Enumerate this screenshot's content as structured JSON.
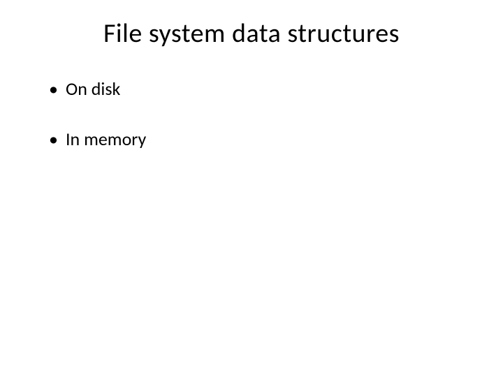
{
  "slide": {
    "title": "File system data structures",
    "bullets": [
      "On disk",
      "In memory"
    ]
  }
}
